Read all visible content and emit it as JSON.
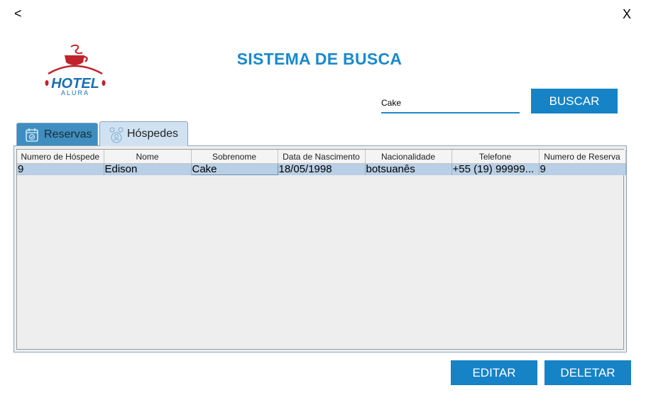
{
  "nav": {
    "back": "<",
    "close": "X"
  },
  "logo": {
    "text_main": "HOTEL",
    "text_sub": "ALURA"
  },
  "title": "SISTEMA DE BUSCA",
  "search": {
    "value": "Cake"
  },
  "buttons": {
    "search": "BUSCAR",
    "edit": "EDITAR",
    "delete": "DELETAR"
  },
  "tabs": [
    {
      "label": "Reservas",
      "icon": "calendar-icon",
      "selected": false
    },
    {
      "label": "Hóspedes",
      "icon": "guests-icon",
      "selected": true
    }
  ],
  "table": {
    "columns": [
      "Numero de Hóspede",
      "Nome",
      "Sobrenome",
      "Data de Nascimento",
      "Nacionalidade",
      "Telefone",
      "Numero de Reserva"
    ],
    "rows": [
      [
        "9",
        "Edison",
        "Cake",
        "18/05/1998",
        "botsuanês",
        "+55 (19) 99999...",
        "9"
      ]
    ]
  },
  "colors": {
    "accent": "#1583c6",
    "title": "#1a8acb",
    "selected_row": "#b8cfe5"
  }
}
